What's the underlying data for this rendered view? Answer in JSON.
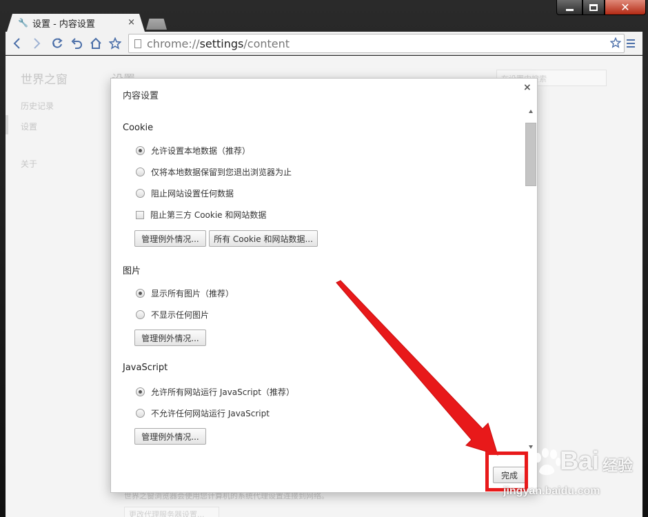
{
  "window": {
    "caption_buttons": {
      "minimize": "minimize-icon",
      "maximize": "maximize-icon",
      "close": "close-icon"
    },
    "close_glyph": "✕"
  },
  "tabs": [
    {
      "title": "设置 - 内容设置",
      "icon": "wrench-icon",
      "close": "×"
    }
  ],
  "toolbar": {
    "url_prefix": "chrome://",
    "url_host": "settings",
    "url_path": "/content",
    "icons": [
      "back-icon",
      "forward-icon",
      "reload-icon",
      "undo-icon",
      "home-icon",
      "star-icon",
      "menu-icon"
    ]
  },
  "settings_page": {
    "brand": "世界之窗",
    "heading": "设置",
    "search_placeholder": "在设置中搜索",
    "nav": [
      {
        "label": "历史记录"
      },
      {
        "label": "设置"
      },
      {
        "label": "关于"
      }
    ],
    "proxy_note": "世界之窗浏览器会使用您计算机的系统代理设置连接到网络。",
    "proxy_button": "更改代理服务器设置..."
  },
  "dialog": {
    "title": "内容设置",
    "close": "×",
    "sections": {
      "cookie": {
        "title": "Cookie",
        "options": [
          {
            "label": "允许设置本地数据（推荐）",
            "selected": true
          },
          {
            "label": "仅将本地数据保留到您退出浏览器为止",
            "selected": false
          },
          {
            "label": "阻止网站设置任何数据",
            "selected": false
          }
        ],
        "checkbox": {
          "label": "阻止第三方 Cookie 和网站数据",
          "checked": false
        },
        "buttons": [
          "管理例外情况...",
          "所有 Cookie 和网站数据..."
        ]
      },
      "images": {
        "title": "图片",
        "options": [
          {
            "label": "显示所有图片（推荐）",
            "selected": true
          },
          {
            "label": "不显示任何图片",
            "selected": false
          }
        ],
        "buttons": [
          "管理例外情况..."
        ]
      },
      "javascript": {
        "title": "JavaScript",
        "options": [
          {
            "label": "允许所有网站运行 JavaScript（推荐）",
            "selected": true
          },
          {
            "label": "不允许任何网站运行 JavaScript",
            "selected": false
          }
        ],
        "buttons": [
          "管理例外情况..."
        ]
      }
    },
    "done_button": "完成"
  },
  "annotation": {
    "arrow_color": "#e8191a",
    "box_color": "#e8191a"
  },
  "watermark": {
    "logo": "Bai",
    "cn": "经验",
    "url": "jingyan.baidu.com"
  }
}
